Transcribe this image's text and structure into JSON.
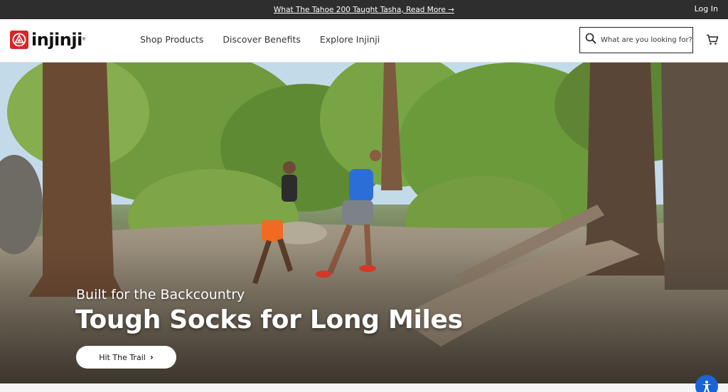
{
  "announcement": {
    "text": "What The Tahoe 200 Taught Tasha, Read More →",
    "login_label": "Log In"
  },
  "brand": {
    "name": "injinji",
    "trademark": "®",
    "accent": "#d8252a"
  },
  "nav": {
    "items": [
      {
        "label": "Shop Products"
      },
      {
        "label": "Discover Benefits"
      },
      {
        "label": "Explore Injinji"
      }
    ]
  },
  "search": {
    "placeholder": "What are you looking for?",
    "value": ""
  },
  "icons": {
    "search": "search-icon",
    "cart": "cart-icon",
    "accessibility": "accessibility-icon",
    "chevron": "chevron-right-icon"
  },
  "hero": {
    "subtitle": "Built for the Backcountry",
    "title": "Tough Socks for Long Miles",
    "cta_label": "Hit The Trail",
    "cta_chevron": "›"
  },
  "colors": {
    "announce_bg": "#2e2e2e",
    "a11y_button": "#1a63d8"
  }
}
